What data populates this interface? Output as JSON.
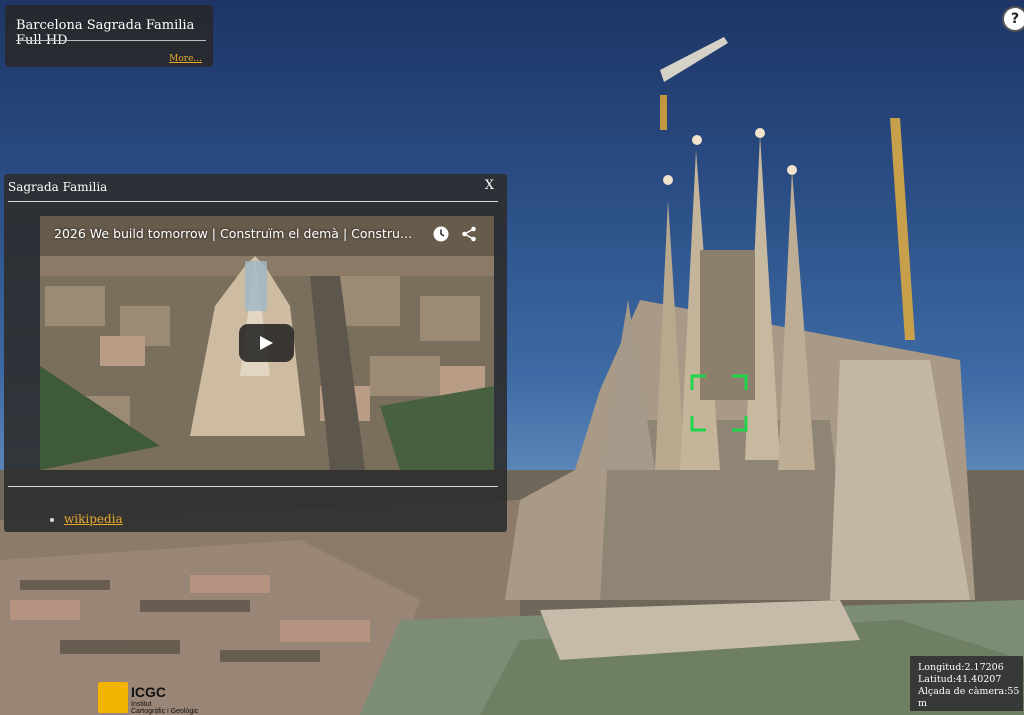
{
  "title_panel": {
    "title": "Barcelona Sagrada Familia Full HD",
    "more_link": "More..."
  },
  "help_button": {
    "label": "?"
  },
  "info_panel": {
    "title": "Sagrada Familia",
    "close_label": "X",
    "video": {
      "title": "2026 We build tomorrow | Construïm el demà | Construimo..."
    },
    "links": [
      "wikipedia"
    ]
  },
  "coords": {
    "longitud": "Longitud:2.17206",
    "latitud": "Latitud:41.40207",
    "altitud": "Alçada de càmera:55 m"
  },
  "logo": {
    "name": "ICGC",
    "sub1": "Institut",
    "sub2": "Cartogràfic i Geològic"
  },
  "colors": {
    "link": "#e5a92d",
    "reticle": "#1fd64a",
    "panel_bg": "#2d2d2d"
  }
}
